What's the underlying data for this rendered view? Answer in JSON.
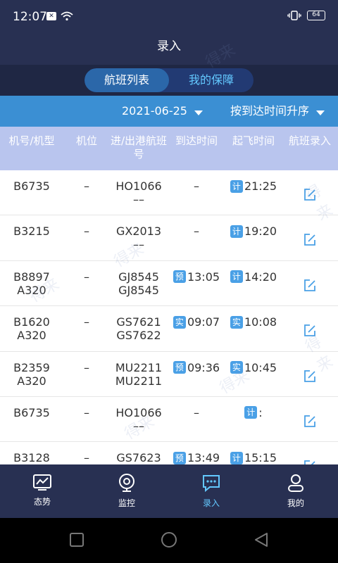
{
  "status": {
    "time": "12:07",
    "battery": "64"
  },
  "title": "录入",
  "tabs": [
    {
      "label": "航班列表",
      "active": true
    },
    {
      "label": "我的保障",
      "active": false
    }
  ],
  "filters": {
    "date": "2021-06-25",
    "sort": "按到达时间升序"
  },
  "columns": [
    "机号/机型",
    "机位",
    "进/出港航班号",
    "到达时间",
    "起飞时间",
    "航班录入"
  ],
  "rows": [
    {
      "reg": "B6735",
      "type": "",
      "stand": "–",
      "flight_in": "HO1066",
      "flight_out": "––",
      "arr_badge": "",
      "arr_time": "–",
      "dep_badge": "计",
      "dep_time": "21:25"
    },
    {
      "reg": "B3215",
      "type": "",
      "stand": "–",
      "flight_in": "GX2013",
      "flight_out": "––",
      "arr_badge": "",
      "arr_time": "–",
      "dep_badge": "计",
      "dep_time": "19:20"
    },
    {
      "reg": "B8897",
      "type": "A320",
      "stand": "–",
      "flight_in": "GJ8545",
      "flight_out": "GJ8545",
      "arr_badge": "预",
      "arr_time": "13:05",
      "dep_badge": "计",
      "dep_time": "14:20"
    },
    {
      "reg": "B1620",
      "type": "A320",
      "stand": "–",
      "flight_in": "GS7621",
      "flight_out": "GS7622",
      "arr_badge": "实",
      "arr_time": "09:07",
      "dep_badge": "实",
      "dep_time": "10:08"
    },
    {
      "reg": "B2359",
      "type": "A320",
      "stand": "–",
      "flight_in": "MU2211",
      "flight_out": "MU2211",
      "arr_badge": "预",
      "arr_time": "09:36",
      "dep_badge": "实",
      "dep_time": "10:45"
    },
    {
      "reg": "B6735",
      "type": "",
      "stand": "–",
      "flight_in": "HO1066",
      "flight_out": "––",
      "arr_badge": "",
      "arr_time": "–",
      "dep_badge": "计",
      "dep_time": ":"
    },
    {
      "reg": "B3128",
      "type": "",
      "stand": "–",
      "flight_in": "GS7623",
      "flight_out": "",
      "arr_badge": "预",
      "arr_time": "13:49",
      "dep_badge": "计",
      "dep_time": "15:15"
    }
  ],
  "bottom_tabs": [
    {
      "label": "态势",
      "icon": "chart-icon",
      "active": false
    },
    {
      "label": "监控",
      "icon": "camera-icon",
      "active": false
    },
    {
      "label": "录入",
      "icon": "chat-icon",
      "active": true
    },
    {
      "label": "我的",
      "icon": "user-icon",
      "active": false
    }
  ],
  "colors": {
    "header": "#283052",
    "accent": "#63c8ff",
    "filter": "#3b8fd3",
    "table_header": "#b9c5ee",
    "badge": "#4aa0e6"
  },
  "watermark": "得来"
}
